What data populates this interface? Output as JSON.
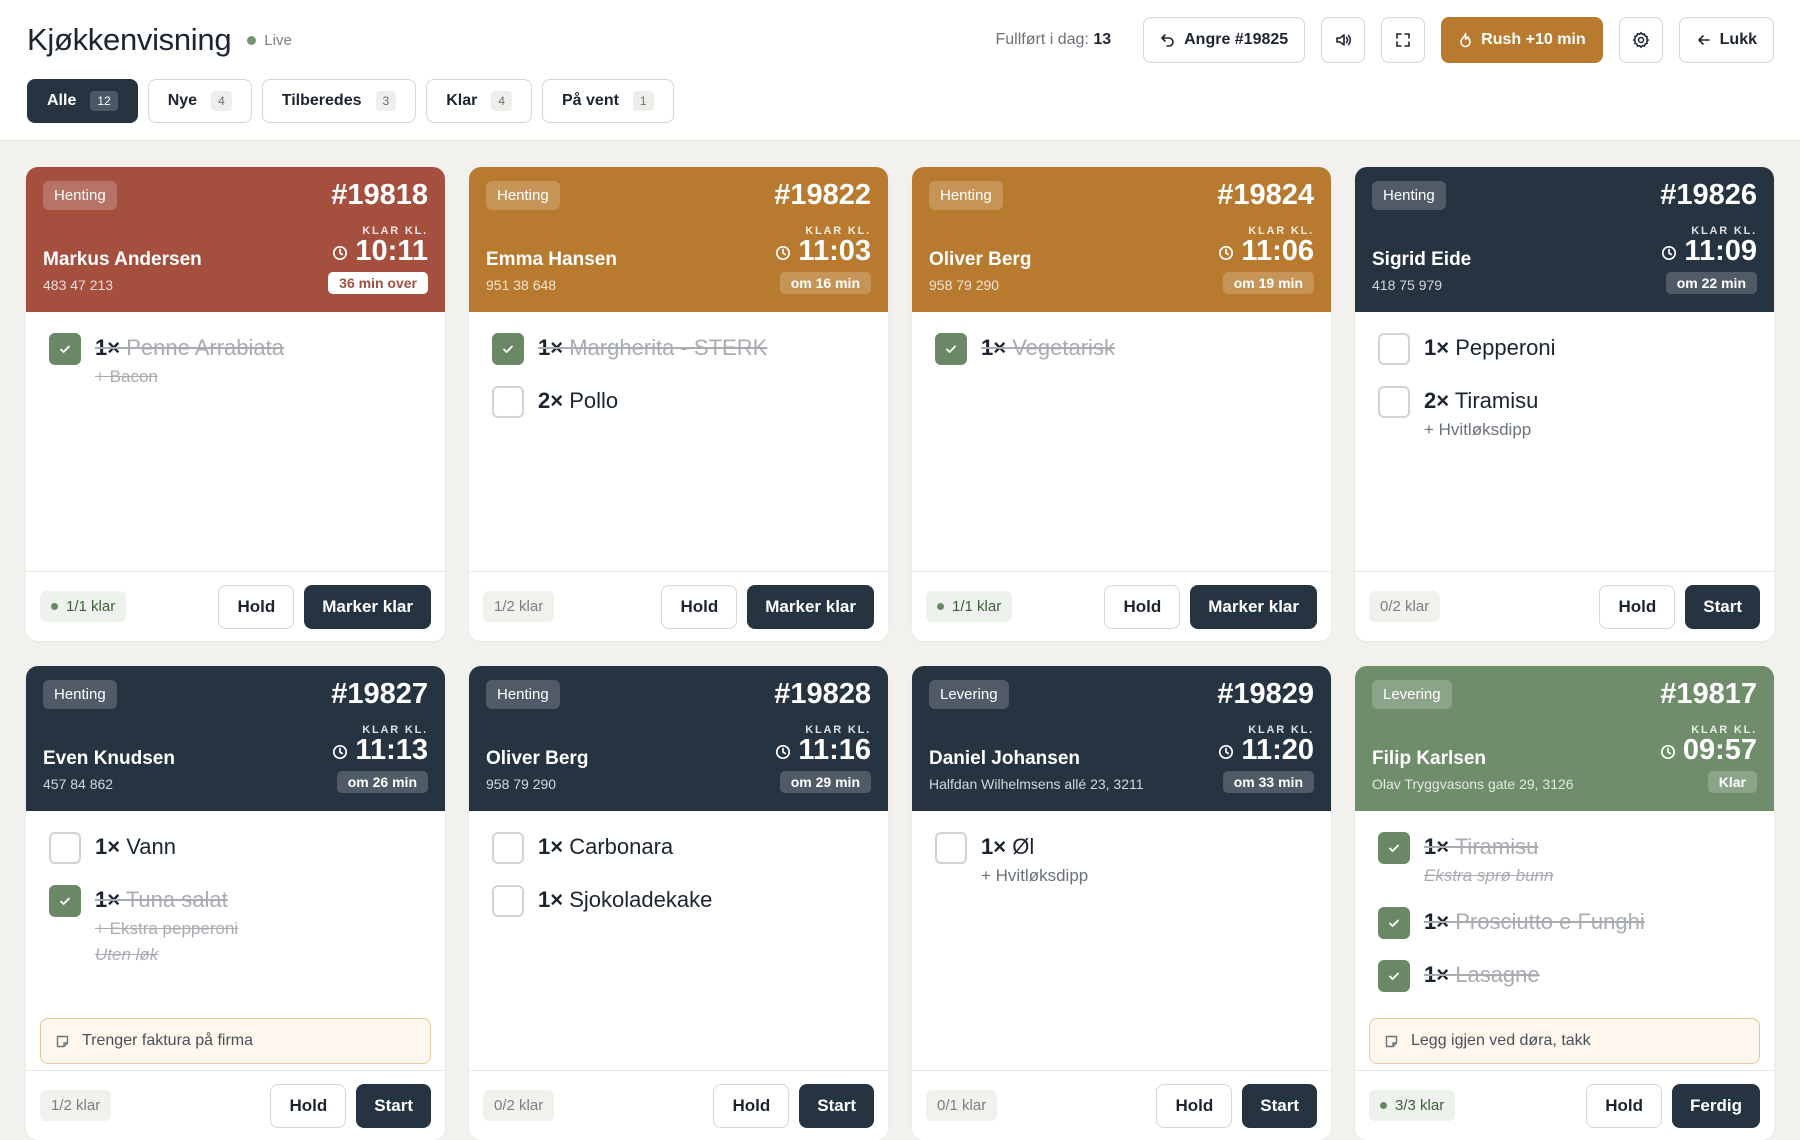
{
  "header": {
    "title": "Kjøkkenvisning",
    "live": "Live",
    "done_label": "Fullført i dag:",
    "done_count": "13",
    "undo": "Angre #19825",
    "rush": "Rush +10 min",
    "close": "Lukk"
  },
  "tabs": [
    {
      "label": "Alle",
      "count": "12"
    },
    {
      "label": "Nye",
      "count": "4"
    },
    {
      "label": "Tilberedes",
      "count": "3"
    },
    {
      "label": "Klar",
      "count": "4"
    },
    {
      "label": "På vent",
      "count": "1"
    }
  ],
  "klar_label": "KLAR KL.",
  "hold_label": "Hold",
  "orders": [
    {
      "type": "Henting",
      "id": "#19818",
      "name": "Markus Andersen",
      "contact": "483 47 213",
      "time": "10:11",
      "eta": "36 min over",
      "items": [
        {
          "qty": "1×",
          "name": "Penne Arrabiata",
          "subs": [
            "+ Bacon"
          ],
          "done": true
        }
      ],
      "progress": "1/1 klar",
      "action": "Marker klar"
    },
    {
      "type": "Henting",
      "id": "#19822",
      "name": "Emma Hansen",
      "contact": "951 38 648",
      "time": "11:03",
      "eta": "om 16 min",
      "items": [
        {
          "qty": "1×",
          "name": "Margherita - STERK",
          "subs": [],
          "done": true
        },
        {
          "qty": "2×",
          "name": "Pollo",
          "subs": [],
          "done": false
        }
      ],
      "progress": "1/2 klar",
      "action": "Marker klar"
    },
    {
      "type": "Henting",
      "id": "#19824",
      "name": "Oliver Berg",
      "contact": "958 79 290",
      "time": "11:06",
      "eta": "om 19 min",
      "items": [
        {
          "qty": "1×",
          "name": "Vegetarisk",
          "subs": [],
          "done": true
        }
      ],
      "progress": "1/1 klar",
      "action": "Marker klar"
    },
    {
      "type": "Henting",
      "id": "#19826",
      "name": "Sigrid Eide",
      "contact": "418 75 979",
      "time": "11:09",
      "eta": "om 22 min",
      "items": [
        {
          "qty": "1×",
          "name": "Pepperoni",
          "subs": [],
          "done": false
        },
        {
          "qty": "2×",
          "name": "Tiramisu",
          "subs": [
            "+ Hvitløksdipp"
          ],
          "done": false
        }
      ],
      "progress": "0/2 klar",
      "action": "Start"
    },
    {
      "type": "Henting",
      "id": "#19827",
      "name": "Even Knudsen",
      "contact": "457 84 862",
      "time": "11:13",
      "eta": "om 26 min",
      "items": [
        {
          "qty": "1×",
          "name": "Vann",
          "subs": [],
          "done": false
        },
        {
          "qty": "1×",
          "name": "Tuna salat",
          "subs": [
            "+ Ekstra pepperoni"
          ],
          "note": "Uten løk",
          "done": true
        }
      ],
      "note": "Trenger faktura på firma",
      "progress": "1/2 klar",
      "action": "Start"
    },
    {
      "type": "Henting",
      "id": "#19828",
      "name": "Oliver Berg",
      "contact": "958 79 290",
      "time": "11:16",
      "eta": "om 29 min",
      "items": [
        {
          "qty": "1×",
          "name": "Carbonara",
          "subs": [],
          "done": false
        },
        {
          "qty": "1×",
          "name": "Sjokoladekake",
          "subs": [],
          "done": false
        }
      ],
      "progress": "0/2 klar",
      "action": "Start"
    },
    {
      "type": "Levering",
      "id": "#19829",
      "name": "Daniel Johansen",
      "contact": "Halfdan Wilhelmsens allé 23, 3211",
      "time": "11:20",
      "eta": "om 33 min",
      "items": [
        {
          "qty": "1×",
          "name": "Øl",
          "subs": [
            "+ Hvitløksdipp"
          ],
          "done": false
        }
      ],
      "progress": "0/1 klar",
      "action": "Start"
    },
    {
      "type": "Levering",
      "id": "#19817",
      "name": "Filip Karlsen",
      "contact": "Olav Tryggvasons gate 29, 3126",
      "time": "09:57",
      "eta": "Klar",
      "items": [
        {
          "qty": "1×",
          "name": "Tiramisu",
          "subs": [],
          "note": "Ekstra sprø bunn",
          "done": true
        },
        {
          "qty": "1×",
          "name": "Prosciutto e Funghi",
          "subs": [],
          "done": true
        },
        {
          "qty": "1×",
          "name": "Lasagne",
          "subs": [],
          "done": true
        }
      ],
      "note": "Legg igjen ved døra, takk",
      "progress": "3/3 klar",
      "action": "Ferdig"
    }
  ],
  "colors": {
    "red": "#a5503f",
    "amber": "#b87a2e",
    "dark": "#263341",
    "green": "#6f8d6b",
    "check": "#6a8865"
  }
}
